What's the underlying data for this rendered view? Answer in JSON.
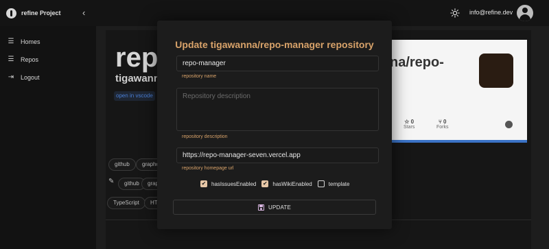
{
  "app": {
    "brand_name": "refine Project",
    "collapse_glyph": "‹",
    "user_email": "info@refine.dev",
    "icons": {
      "brand": "refine-logo-icon",
      "theme": "sun-icon",
      "avatar": "user-avatar-icon"
    }
  },
  "sidebar": {
    "items": [
      {
        "label": "Homes",
        "icon": "list-icon",
        "glyph": "☰"
      },
      {
        "label": "Repos",
        "icon": "list-icon",
        "glyph": "☰"
      },
      {
        "label": "Logout",
        "icon": "logout-icon",
        "glyph": "⇥"
      }
    ]
  },
  "background": {
    "repo_title": "repo",
    "repo_owner": "tigawann",
    "open_in_vscode": "open in vscode",
    "card": {
      "title": "na/repo-",
      "stats": [
        {
          "value": "0",
          "label": "Stars",
          "icon": "star-icon"
        },
        {
          "value": "0",
          "label": "Forks",
          "icon": "fork-icon"
        }
      ],
      "s_fragment": "s"
    },
    "chips_row1": [
      "github",
      "grapho"
    ],
    "chips_row2": [
      "github",
      "grap"
    ],
    "chips_row3": [
      "TypeScript",
      "HT"
    ]
  },
  "modal": {
    "title": "Update tigawanna/repo-manager repository",
    "name_value": "repo-manager",
    "name_helper": "repository name",
    "description_placeholder": "Repository description",
    "description_helper": "repository description",
    "homepage_value": "https://repo-manager-seven.vercel.app",
    "homepage_helper": "repository homepage url",
    "checkboxes": [
      {
        "label": "hasIssuesEnabled",
        "checked": true
      },
      {
        "label": "hasWikiEnabled",
        "checked": true
      },
      {
        "label": "template",
        "checked": false
      }
    ],
    "update_label": "UPDATE",
    "colors": {
      "accent": "#d9a36a",
      "check": "#e7c7a7"
    }
  }
}
